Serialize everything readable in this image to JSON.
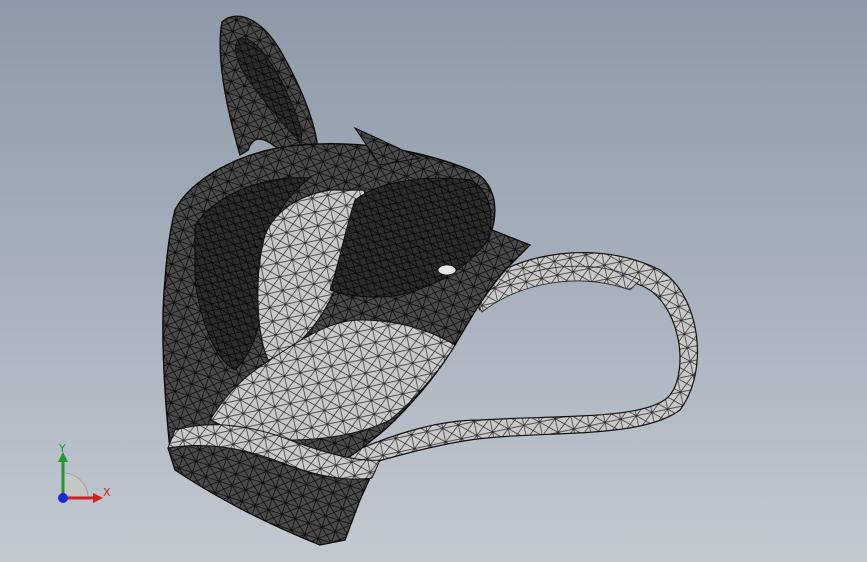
{
  "viewport": {
    "background_top": "#8e9aa9",
    "background_bottom": "#c3c9d1",
    "model": "mesh-model",
    "display_style": "wireframe-mesh"
  },
  "triad": {
    "x_label": "X",
    "y_label": "Y",
    "x_color": "#d21f1f",
    "y_color": "#1e9a2a",
    "z_color": "#1a2bd6"
  }
}
